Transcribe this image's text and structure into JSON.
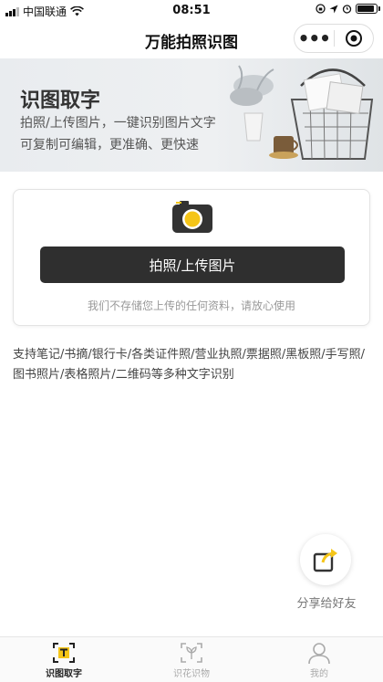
{
  "status_bar": {
    "carrier": "中国联通",
    "time": "08:51",
    "battery_level": 0.9
  },
  "nav": {
    "title": "万能拍照识图",
    "more_label": "•••"
  },
  "banner": {
    "title": "识图取字",
    "subtitle_line1": "拍照/上传图片，一键识别图片文字",
    "subtitle_line2": "可复制可编辑，更准确、更快速"
  },
  "upload": {
    "button_label": "拍照/上传图片",
    "privacy_note": "我们不存储您上传的任何资料，请放心使用"
  },
  "support_text": "支持笔记/书摘/银行卡/各类证件照/营业执照/票据照/黑板照/手写照/图书照片/表格照片/二维码等多种文字识别",
  "share": {
    "label": "分享给好友"
  },
  "tabs": [
    {
      "label": "识图取字",
      "icon": "text-scan-icon",
      "active": true
    },
    {
      "label": "识花识物",
      "icon": "flower-scan-icon",
      "active": false
    },
    {
      "label": "我的",
      "icon": "user-icon",
      "active": false
    }
  ],
  "colors": {
    "accent": "#f5c518",
    "button_dark": "#2f2f2f",
    "inactive_tab": "#aaaaaa"
  }
}
